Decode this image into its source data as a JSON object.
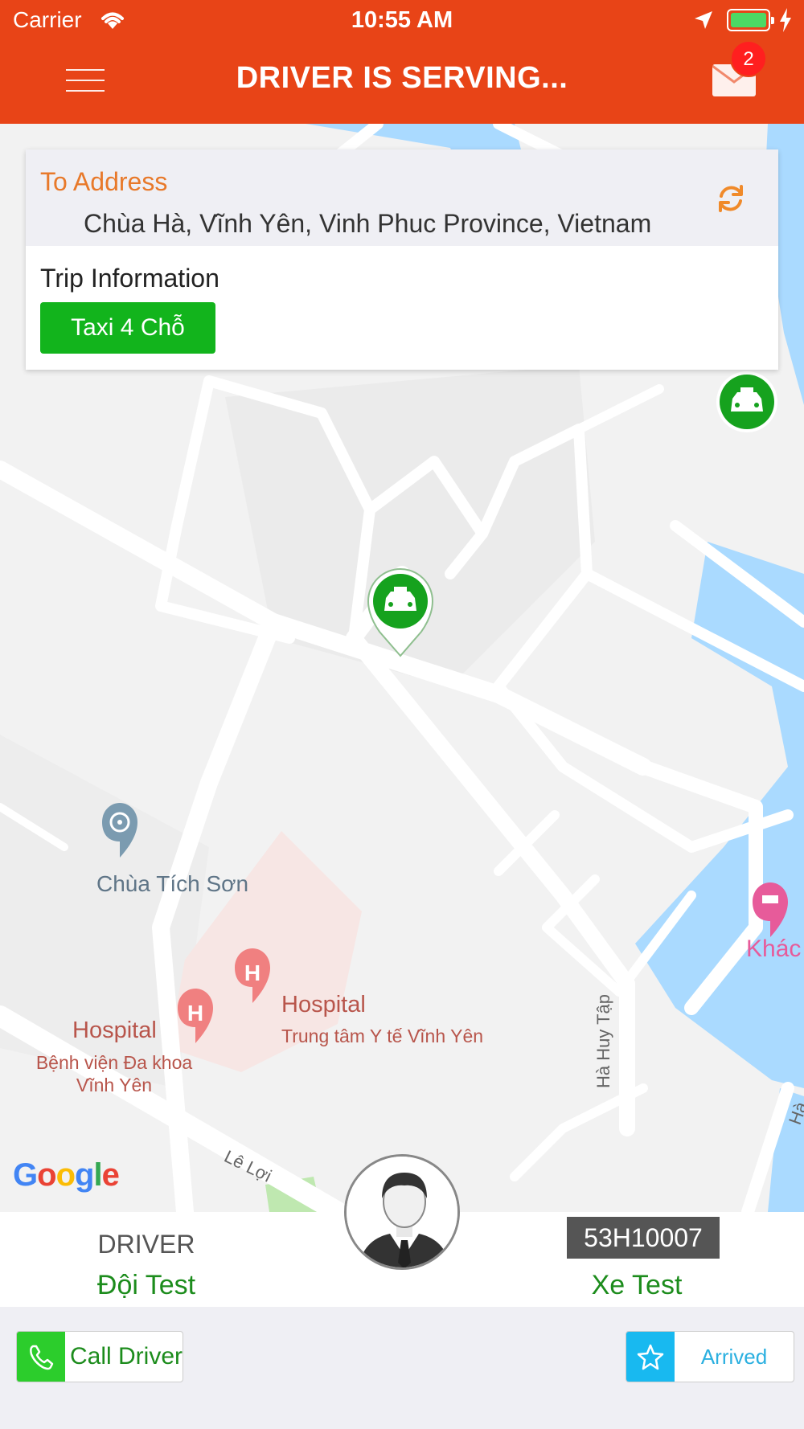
{
  "status_bar": {
    "carrier": "Carrier",
    "time": "10:55 AM"
  },
  "header": {
    "title": "DRIVER IS SERVING...",
    "mail_badge": "2",
    "menu_icon": "hamburger-menu-icon",
    "mail_icon": "mail-icon"
  },
  "address_card": {
    "to_label": "To Address",
    "to_address": "Chùa Hà, Vĩnh Yên, Vinh Phuc Province, Vietnam",
    "trip_label": "Trip Information",
    "vehicle_type": "Taxi 4 Chỗ",
    "refresh_icon": "refresh-icon"
  },
  "map": {
    "places": [
      {
        "name": "Chùa Tích Sơn"
      },
      {
        "name": "Hospital",
        "sub": "Trung tâm Y tế Vĩnh Yên"
      },
      {
        "name": "Hospital",
        "sub": "Bệnh viện Đa khoa Vĩnh Yên"
      },
      {
        "name": "Khác"
      }
    ],
    "streets": [
      "Hà Huy Tập",
      "Lê Lợi",
      "Hà"
    ],
    "logo": "Google"
  },
  "driver": {
    "role": "DRIVER",
    "name": "Đội Test",
    "plate": "53H10007",
    "car": "Xe Test"
  },
  "actions": {
    "call_label": "Call Driver",
    "arrived_label": "Arrived"
  },
  "colors": {
    "header": "#e84417",
    "accent_green": "#12b41c",
    "accent_blue": "#18b9f0",
    "address_label": "#e8792a"
  }
}
